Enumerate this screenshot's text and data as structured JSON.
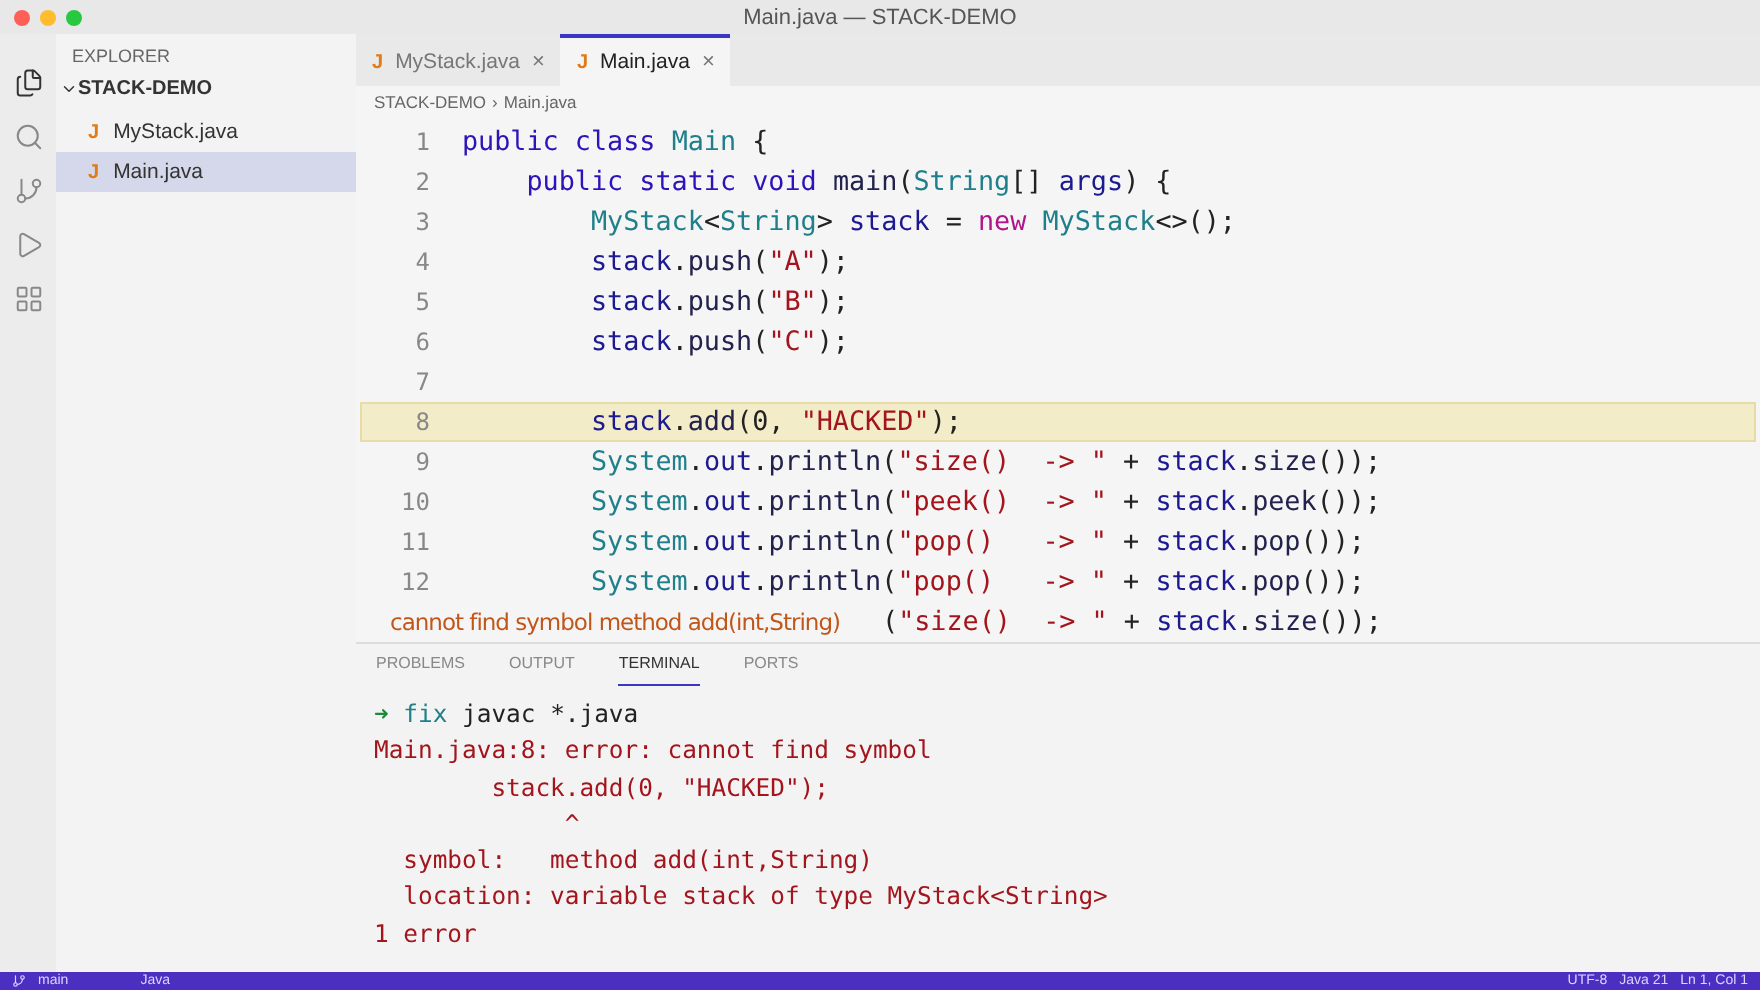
{
  "window": {
    "title": "Main.java — STACK-DEMO"
  },
  "activity_bar": [
    {
      "kind": "explorer",
      "selected": true
    },
    {
      "kind": "search",
      "selected": false
    },
    {
      "kind": "source",
      "selected": false
    },
    {
      "kind": "run",
      "selected": false
    },
    {
      "kind": "extensions",
      "selected": false
    }
  ],
  "sidebar": {
    "title": "EXPLORER",
    "folder": "STACK-DEMO",
    "expanded": true,
    "files": [
      {
        "icon": "J",
        "name": "MyStack.java",
        "selected": false
      },
      {
        "icon": "J",
        "name": "Main.java",
        "selected": true
      }
    ]
  },
  "tabs": [
    {
      "icon": "J",
      "label": "MyStack.java",
      "close": "×",
      "selected": false
    },
    {
      "icon": "J",
      "label": "Main.java",
      "close": "×",
      "selected": true
    }
  ],
  "breadcrumb": [
    "STACK-DEMO",
    "›",
    "Main.java"
  ],
  "code": [
    {
      "number": "1",
      "highlighted": false,
      "tokens": [
        {
          "kind": "kw",
          "text": "public class "
        },
        {
          "kind": "type",
          "text": "Main"
        },
        {
          "kind": "plain",
          "text": " {"
        }
      ]
    },
    {
      "number": "2",
      "highlighted": false,
      "tokens": [
        {
          "kind": "kw",
          "text": "    public static void "
        },
        {
          "kind": "fn",
          "text": "main"
        },
        {
          "kind": "plain",
          "text": "("
        },
        {
          "kind": "type",
          "text": "String"
        },
        {
          "kind": "plain",
          "text": "[] "
        },
        {
          "kind": "var",
          "text": "args"
        },
        {
          "kind": "plain",
          "text": ") {"
        }
      ]
    },
    {
      "number": "3",
      "highlighted": false,
      "tokens": [
        {
          "kind": "type",
          "text": "        MyStack"
        },
        {
          "kind": "plain",
          "text": "<"
        },
        {
          "kind": "type",
          "text": "String"
        },
        {
          "kind": "plain",
          "text": "> "
        },
        {
          "kind": "var",
          "text": "stack"
        },
        {
          "kind": "plain",
          "text": " = "
        },
        {
          "kind": "kw2",
          "text": "new "
        },
        {
          "kind": "type",
          "text": "MyStack"
        },
        {
          "kind": "plain",
          "text": "<>();"
        }
      ]
    },
    {
      "number": "4",
      "highlighted": false,
      "tokens": [
        {
          "kind": "var",
          "text": "        stack"
        },
        {
          "kind": "plain",
          "text": "."
        },
        {
          "kind": "fn",
          "text": "push"
        },
        {
          "kind": "plain",
          "text": "("
        },
        {
          "kind": "str",
          "text": "\"A\""
        },
        {
          "kind": "plain",
          "text": ");"
        }
      ]
    },
    {
      "number": "5",
      "highlighted": false,
      "tokens": [
        {
          "kind": "var",
          "text": "        stack"
        },
        {
          "kind": "plain",
          "text": "."
        },
        {
          "kind": "fn",
          "text": "push"
        },
        {
          "kind": "plain",
          "text": "("
        },
        {
          "kind": "str",
          "text": "\"B\""
        },
        {
          "kind": "plain",
          "text": ");"
        }
      ]
    },
    {
      "number": "6",
      "highlighted": false,
      "tokens": [
        {
          "kind": "var",
          "text": "        stack"
        },
        {
          "kind": "plain",
          "text": "."
        },
        {
          "kind": "fn",
          "text": "push"
        },
        {
          "kind": "plain",
          "text": "("
        },
        {
          "kind": "str",
          "text": "\"C\""
        },
        {
          "kind": "plain",
          "text": ");"
        }
      ]
    },
    {
      "number": "7",
      "highlighted": false
    },
    {
      "number": "8",
      "highlighted": true,
      "tokens": [
        {
          "kind": "var",
          "text": "        stack"
        },
        {
          "kind": "plain",
          "text": "."
        },
        {
          "kind": "fn",
          "text": "add"
        },
        {
          "kind": "plain",
          "text": "(0, "
        },
        {
          "kind": "str",
          "text": "\"HACKED\""
        },
        {
          "kind": "plain",
          "text": ");"
        }
      ]
    },
    {
      "number": "9",
      "highlighted": false,
      "tokens": [
        {
          "kind": "type",
          "text": "        System"
        },
        {
          "kind": "plain",
          "text": "."
        },
        {
          "kind": "var",
          "text": "out"
        },
        {
          "kind": "plain",
          "text": "."
        },
        {
          "kind": "fn",
          "text": "println"
        },
        {
          "kind": "plain",
          "text": "("
        },
        {
          "kind": "str",
          "text": "\"size()  -> \""
        },
        {
          "kind": "plain",
          "text": " + "
        },
        {
          "kind": "var",
          "text": "stack"
        },
        {
          "kind": "plain",
          "text": "."
        },
        {
          "kind": "fn",
          "text": "size"
        },
        {
          "kind": "plain",
          "text": "());"
        }
      ]
    },
    {
      "number": "10",
      "highlighted": false,
      "tokens": [
        {
          "kind": "type",
          "text": "        System"
        },
        {
          "kind": "plain",
          "text": "."
        },
        {
          "kind": "var",
          "text": "out"
        },
        {
          "kind": "plain",
          "text": "."
        },
        {
          "kind": "fn",
          "text": "println"
        },
        {
          "kind": "plain",
          "text": "("
        },
        {
          "kind": "str",
          "text": "\"peek()  -> \""
        },
        {
          "kind": "plain",
          "text": " + "
        },
        {
          "kind": "var",
          "text": "stack"
        },
        {
          "kind": "plain",
          "text": "."
        },
        {
          "kind": "fn",
          "text": "peek"
        },
        {
          "kind": "plain",
          "text": "());"
        }
      ]
    },
    {
      "number": "11",
      "highlighted": false,
      "tokens": [
        {
          "kind": "type",
          "text": "        System"
        },
        {
          "kind": "plain",
          "text": "."
        },
        {
          "kind": "var",
          "text": "out"
        },
        {
          "kind": "plain",
          "text": "."
        },
        {
          "kind": "fn",
          "text": "println"
        },
        {
          "kind": "plain",
          "text": "("
        },
        {
          "kind": "str",
          "text": "\"pop()   -> \""
        },
        {
          "kind": "plain",
          "text": " + "
        },
        {
          "kind": "var",
          "text": "stack"
        },
        {
          "kind": "plain",
          "text": "."
        },
        {
          "kind": "fn",
          "text": "pop"
        },
        {
          "kind": "plain",
          "text": "());"
        }
      ]
    },
    {
      "number": "12",
      "highlighted": false,
      "tokens": [
        {
          "kind": "type",
          "text": "        System"
        },
        {
          "kind": "plain",
          "text": "."
        },
        {
          "kind": "var",
          "text": "out"
        },
        {
          "kind": "plain",
          "text": "."
        },
        {
          "kind": "fn",
          "text": "println"
        },
        {
          "kind": "plain",
          "text": "("
        },
        {
          "kind": "str",
          "text": "\"pop()   -> \""
        },
        {
          "kind": "plain",
          "text": " + "
        },
        {
          "kind": "var",
          "text": "stack"
        },
        {
          "kind": "plain",
          "text": "."
        },
        {
          "kind": "fn",
          "text": "pop"
        },
        {
          "kind": "plain",
          "text": "());"
        }
      ]
    },
    {
      "highlighted": false,
      "annotation": "cannot find symbol method add(int,String)",
      "tokens": [
        {
          "kind": "plain",
          "text": "("
        },
        {
          "kind": "str",
          "text": "\"size()  -> \""
        },
        {
          "kind": "plain",
          "text": " + "
        },
        {
          "kind": "var",
          "text": "stack"
        },
        {
          "kind": "plain",
          "text": "."
        },
        {
          "kind": "fn",
          "text": "size"
        },
        {
          "kind": "plain",
          "text": "());"
        }
      ]
    }
  ],
  "panel_tabs": [
    {
      "label": "PROBLEMS",
      "selected": false
    },
    {
      "label": "OUTPUT",
      "selected": false
    },
    {
      "label": "TERMINAL",
      "selected": true
    },
    {
      "label": "PORTS",
      "selected": false
    }
  ],
  "terminal": [
    {
      "tokens": [
        {
          "kind": "arrow",
          "text": "➜"
        },
        {
          "kind": "dir",
          "text": " fix"
        },
        {
          "kind": "plain",
          "text": " javac *.java"
        }
      ]
    },
    {
      "tokens": [
        {
          "kind": "error",
          "text": "Main.java:8: error: cannot find symbol"
        }
      ]
    },
    {
      "tokens": [
        {
          "kind": "error",
          "text": "        stack.add(0, \"HACKED\");"
        }
      ]
    },
    {
      "tokens": [
        {
          "kind": "error",
          "text": "             ^"
        }
      ]
    },
    {
      "tokens": [
        {
          "kind": "error",
          "text": "  symbol:   method add(int,String)"
        }
      ]
    },
    {
      "tokens": [
        {
          "kind": "error",
          "text": "  location: variable stack of type MyStack<String>"
        }
      ]
    },
    {
      "tokens": [
        {
          "kind": "error",
          "text": "1 error"
        }
      ]
    }
  ],
  "status_bar": {
    "branch": "main",
    "language": "Java",
    "right": [
      "UTF-8",
      "Java 21",
      "Ln 1, Col 1"
    ]
  }
}
